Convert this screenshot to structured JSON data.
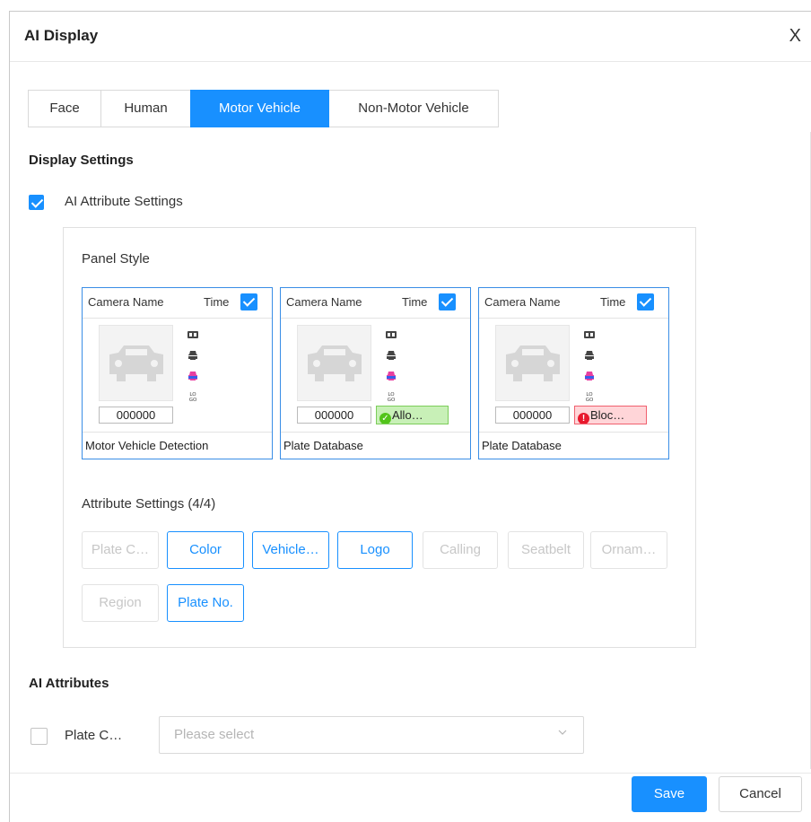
{
  "dialog": {
    "title": "AI Display",
    "close_symbol": "X"
  },
  "tabs": [
    {
      "label": "Face",
      "active": false
    },
    {
      "label": "Human",
      "active": false
    },
    {
      "label": "Motor Vehicle",
      "active": true
    },
    {
      "label": "Non-Motor Vehicle",
      "active": false
    }
  ],
  "display_settings": {
    "title": "Display Settings",
    "ai_attribute_settings": {
      "label": "AI Attribute Settings",
      "checked": true
    },
    "panel_style_label": "Panel Style",
    "cards": [
      {
        "camera_name": "Camera Name",
        "time_label": "Time",
        "time_checked": true,
        "plate": "000000",
        "status": "",
        "status_type": "none",
        "footer": "Motor Vehicle Detection"
      },
      {
        "camera_name": "Camera Name",
        "time_label": "Time",
        "time_checked": true,
        "plate": "000000",
        "status": "Allo…",
        "status_type": "allow",
        "footer": "Plate Database"
      },
      {
        "camera_name": "Camera Name",
        "time_label": "Time",
        "time_checked": true,
        "plate": "000000",
        "status": "Bloc…",
        "status_type": "block",
        "footer": "Plate Database"
      }
    ],
    "attribute_settings_label": "Attribute Settings (4/4)",
    "attributes": [
      {
        "label": "Plate C…",
        "selected": false
      },
      {
        "label": "Color",
        "selected": true
      },
      {
        "label": "Vehicle…",
        "selected": true
      },
      {
        "label": "Logo",
        "selected": true
      },
      {
        "label": "Calling",
        "selected": false
      },
      {
        "label": "Seatbelt",
        "selected": false
      },
      {
        "label": "Ornam…",
        "selected": false
      },
      {
        "label": "Region",
        "selected": false
      },
      {
        "label": "Plate No.",
        "selected": true
      }
    ]
  },
  "ai_attributes": {
    "title": "AI Attributes",
    "plate_color": {
      "label": "Plate C…",
      "checked": false,
      "placeholder": "Please select"
    }
  },
  "footer": {
    "save_label": "Save",
    "cancel_label": "Cancel"
  },
  "colors": {
    "accent": "#1890ff",
    "allow_bg": "#c8f0b7",
    "block_bg": "#ffd5d8"
  }
}
